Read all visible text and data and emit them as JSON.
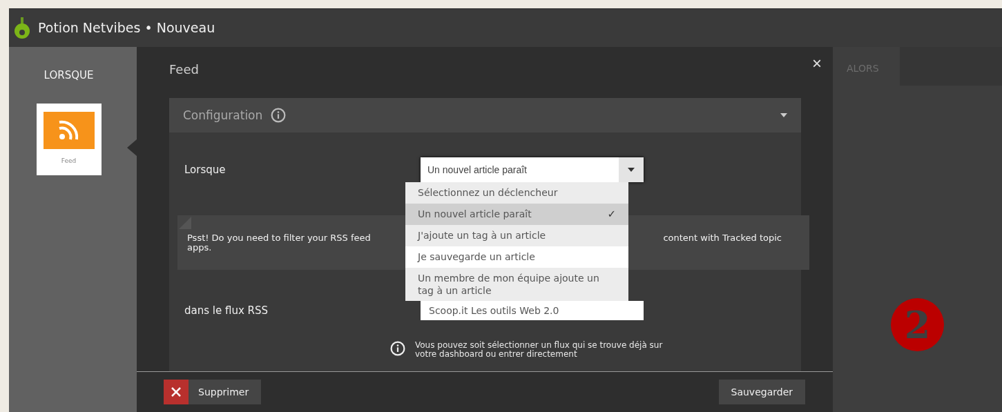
{
  "window": {
    "app": "Potion Netvibes",
    "separator": "•",
    "title": "Nouveau"
  },
  "sidebar": {
    "heading": "LORSQUE",
    "items": [
      {
        "label": "Feed",
        "selected": true
      }
    ]
  },
  "modal": {
    "title": "Feed",
    "close": "×",
    "section": {
      "title": "Configuration",
      "expanded": true
    },
    "trigger": {
      "label": "Lorsque",
      "value": "Un nouvel article paraît",
      "expanded": true,
      "check": "✓",
      "options": [
        {
          "label": "Sélectionnez un déclencheur",
          "selected": false,
          "hovered": false
        },
        {
          "label": "Un nouvel article paraît",
          "selected": true,
          "hovered": false
        },
        {
          "label": "J'ajoute un tag à un article",
          "selected": false,
          "hovered": false
        },
        {
          "label": "Je sauvegarde un article",
          "selected": false,
          "hovered": true
        },
        {
          "label": "Un membre de mon équipe ajoute un tag à un article",
          "selected": false,
          "hovered": false
        }
      ]
    },
    "hint": {
      "start": "Psst! Do you need to filter your RSS feed",
      "end": "content with Tracked topic",
      "tail": "apps."
    },
    "feed": {
      "label": "dans le flux RSS",
      "value": "Scoop.it Les outils Web 2.0"
    },
    "info": "Vous pouvez soit sélectionner un flux qui se trouve déjà sur votre dashboard ou entrer directement",
    "footer": {
      "delete": "Supprimer",
      "save": "Sauvegarder"
    }
  },
  "right": {
    "tabs": [
      {
        "label": "ALORS",
        "selected": true
      }
    ]
  },
  "badge": "2"
}
